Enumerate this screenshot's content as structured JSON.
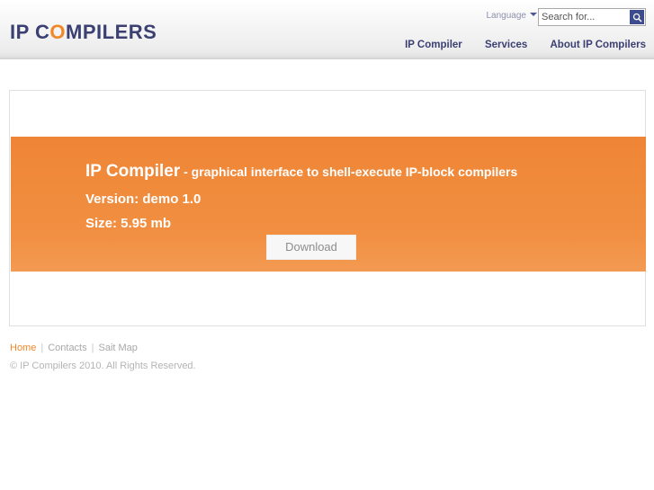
{
  "site": {
    "logo_prefix": "IP C",
    "logo_accent": "O",
    "logo_suffix": "MPILERS"
  },
  "header": {
    "language_label": "Language",
    "language_caret_icon": "chevron-down-icon",
    "search_placeholder": "Search for...",
    "search_value": "",
    "search_icon": "search-icon"
  },
  "nav": {
    "items": [
      {
        "label": "IP Compiler"
      },
      {
        "label": "Services"
      },
      {
        "label": "About IP Compilers"
      }
    ]
  },
  "banner": {
    "product_name": "IP Compiler",
    "tagline": " - graphical interface to shell-execute IP-block compilers",
    "version": "Version: demo 1.0",
    "size": "Size: 5.95 mb",
    "download_label": "Download",
    "bg_color": "#ef8536"
  },
  "footer": {
    "links": [
      {
        "label": "Home"
      },
      {
        "label": "Contacts"
      },
      {
        "label": "Sait Map"
      }
    ],
    "separator": "|",
    "copyright": "© IP Compilers 2010. All Rights Reserved."
  },
  "colors": {
    "accent_orange": "#f08828",
    "brand_navy": "#3b3f72",
    "search_button": "#3c4a8e"
  }
}
